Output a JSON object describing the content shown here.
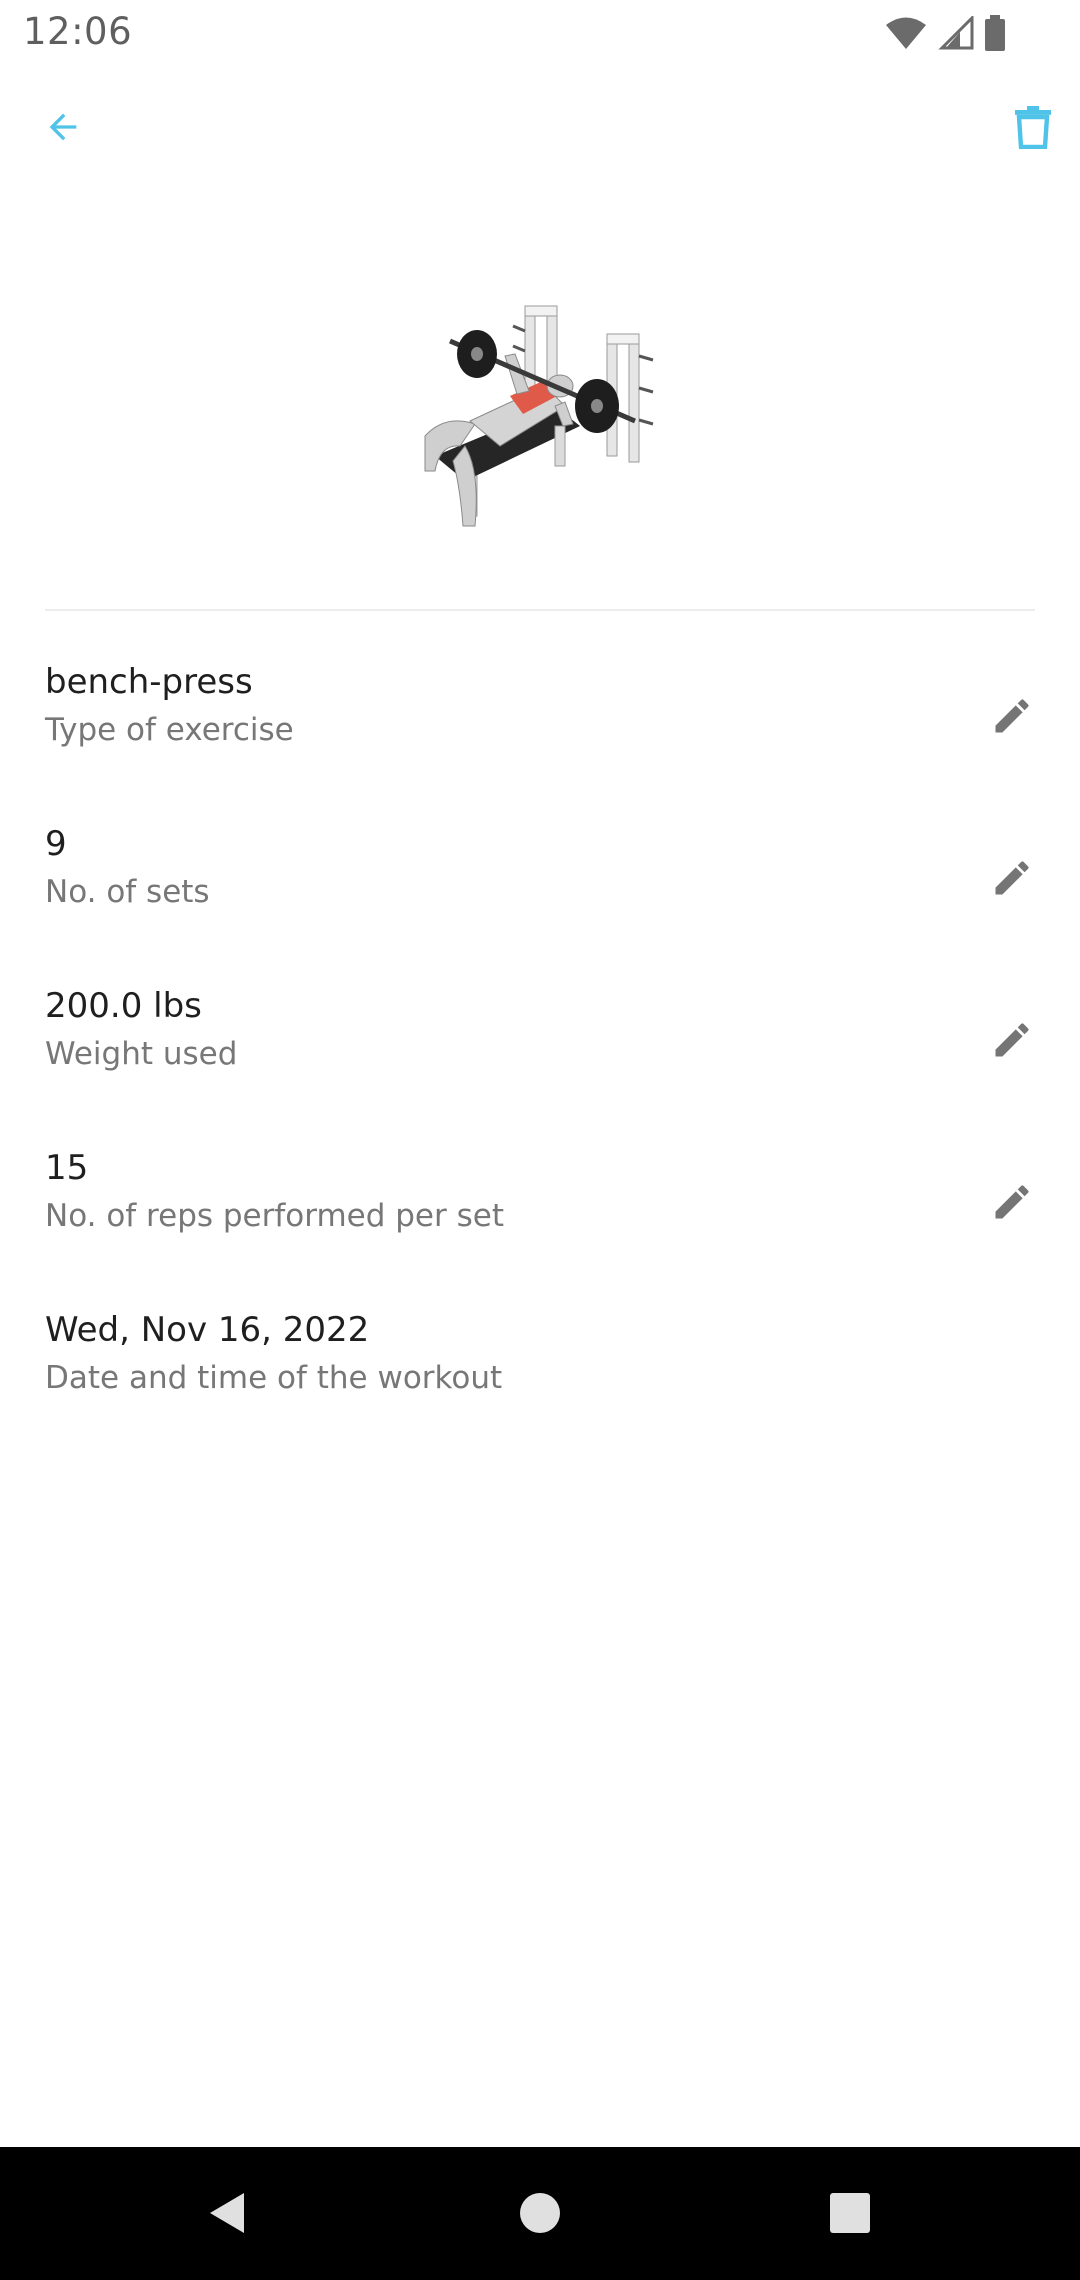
{
  "status_bar": {
    "time": "12:06",
    "icons": [
      "wifi-icon",
      "cell-signal-icon",
      "battery-icon"
    ]
  },
  "app_bar": {
    "back_icon": "arrow-left-icon",
    "delete_icon": "trash-icon",
    "accent_color": "#4fc3e8"
  },
  "exercise_image": {
    "icon": "bench-press-illustration"
  },
  "details": [
    {
      "value": "bench-press",
      "label": "Type of exercise",
      "editable": true
    },
    {
      "value": "9",
      "label": "No. of sets",
      "editable": true
    },
    {
      "value": "200.0 lbs",
      "label": "Weight used",
      "editable": true
    },
    {
      "value": "15",
      "label": "No. of reps performed per set",
      "editable": true
    },
    {
      "value": "Wed, Nov 16, 2022",
      "label": "Date and time of the workout",
      "editable": false
    }
  ],
  "nav_bar": {
    "icons": [
      "back-triangle-icon",
      "home-circle-icon",
      "recents-square-icon"
    ]
  }
}
